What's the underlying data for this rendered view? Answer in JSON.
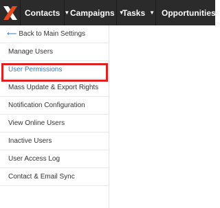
{
  "colors": {
    "topbar_bg": "#2b2b2b",
    "logo_accent": "#e8481e",
    "active_link": "#2a7bbf",
    "highlight": "#e02020"
  },
  "topnav": {
    "items": [
      {
        "label": "Contacts"
      },
      {
        "label": "Campaigns"
      },
      {
        "label": "Tasks"
      },
      {
        "label": "Opportunities"
      }
    ]
  },
  "sidebar": {
    "back_label": "Back to Main Settings",
    "items": [
      {
        "label": "Manage Users"
      },
      {
        "label": "User Permissions",
        "active": true
      },
      {
        "label": "Mass Update & Export Rights"
      },
      {
        "label": "Notification Configuration"
      },
      {
        "label": "View Online Users"
      },
      {
        "label": "Inactive Users"
      },
      {
        "label": "User Access Log"
      },
      {
        "label": "Contact & Email Sync"
      }
    ]
  }
}
